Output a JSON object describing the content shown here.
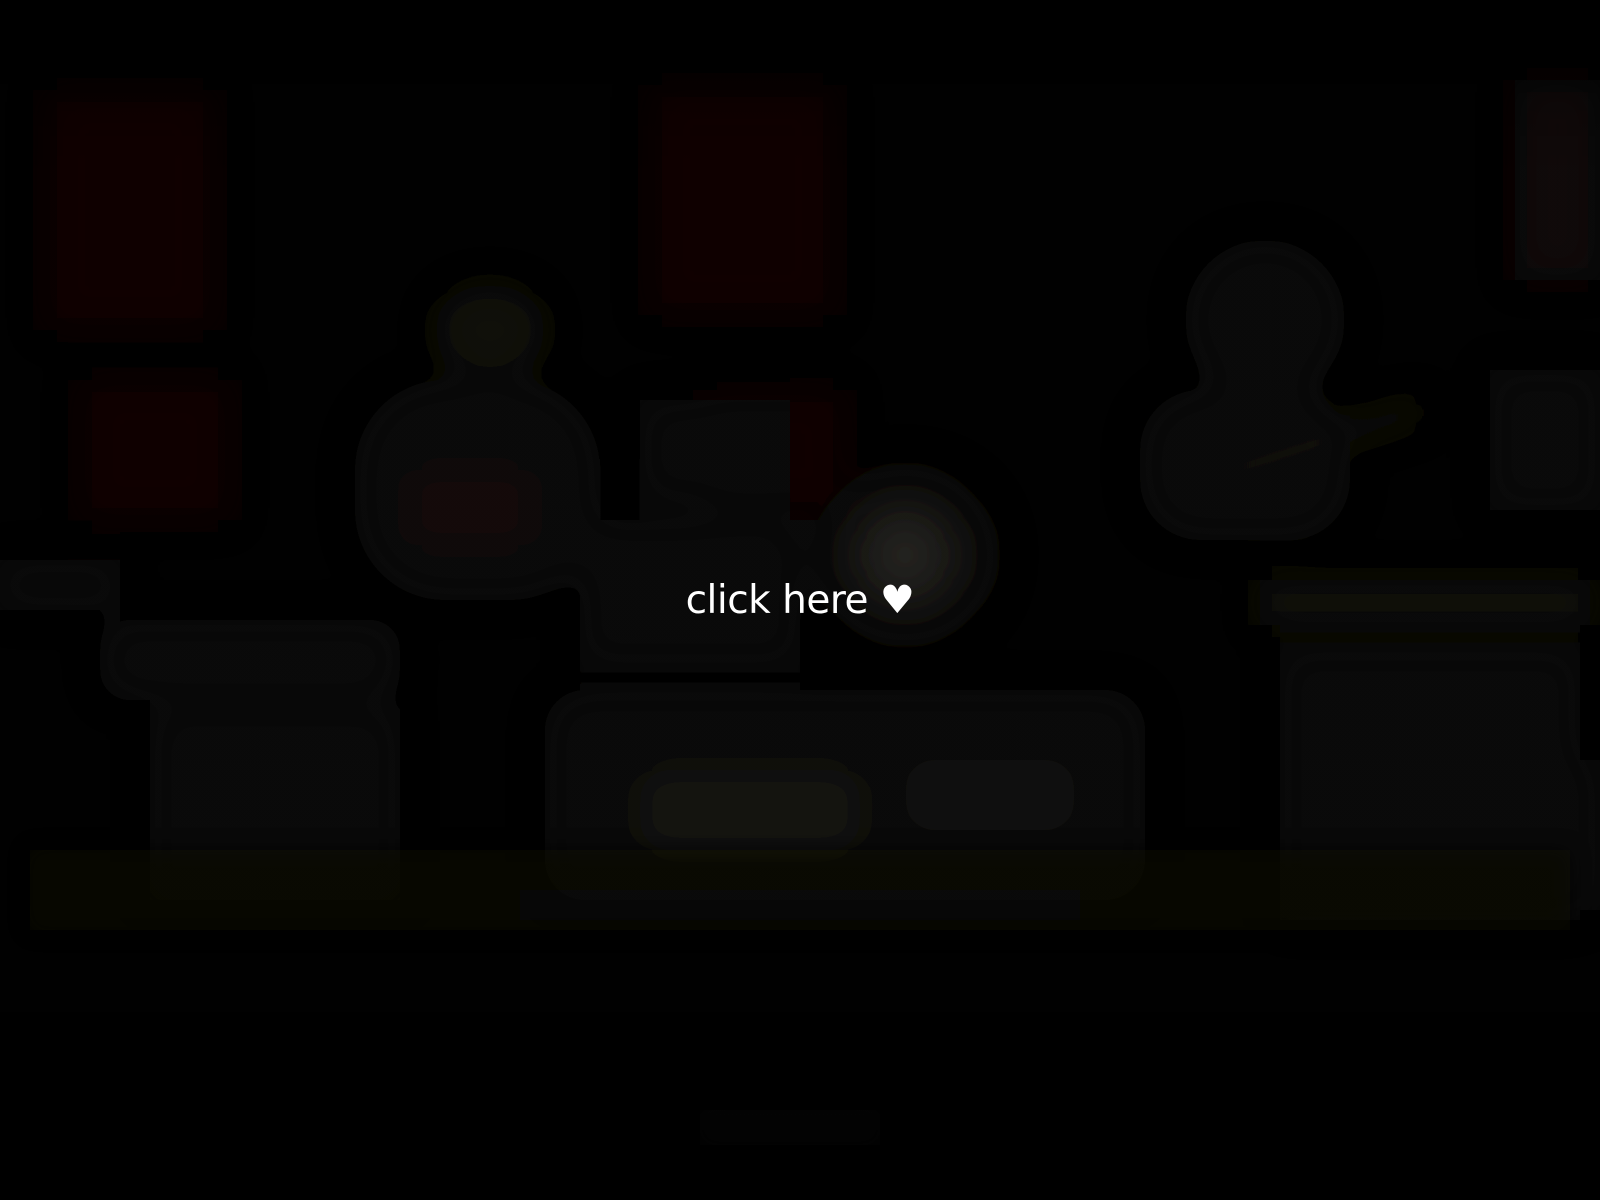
{
  "background": {
    "description_icon": "blurred-stage-photo",
    "colors": {
      "base": "#020202",
      "warm_red": "#1a0404",
      "dark_brown": "#14100b",
      "soft_white": "#2a2925",
      "shadow": "#050505"
    }
  },
  "cta": {
    "label": "click here ♥",
    "color": "#ffffff"
  }
}
